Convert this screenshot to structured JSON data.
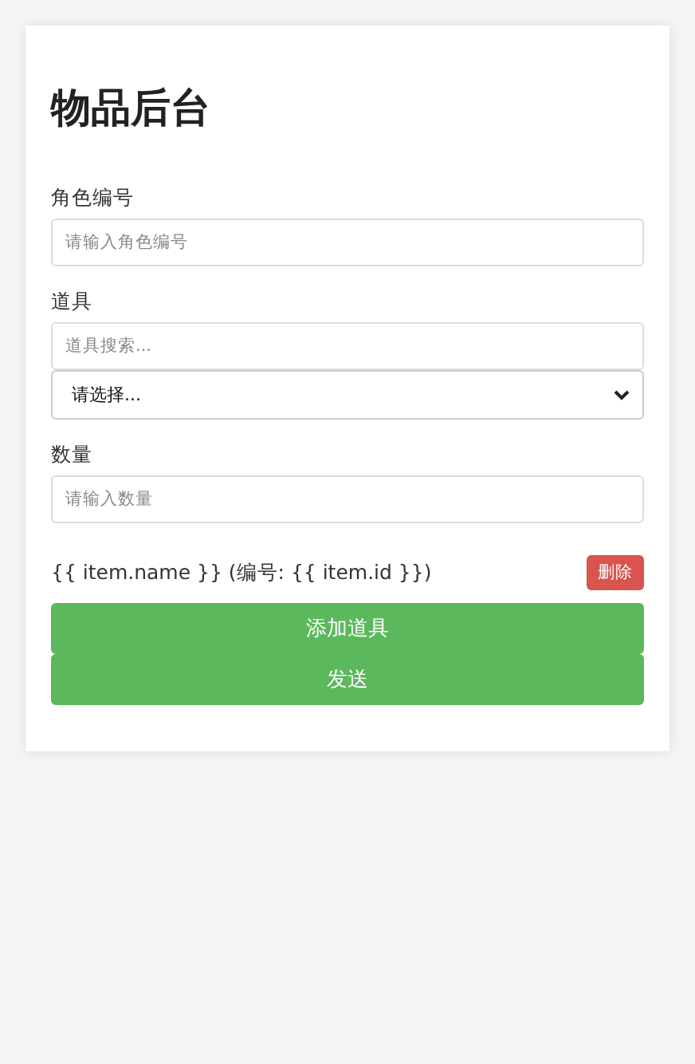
{
  "title": "物品后台",
  "fields": [
    {
      "label": "角色编号",
      "kind": "input",
      "placeholder": "请输入角色编号"
    },
    {
      "label": "道具",
      "kind": "search_select",
      "placeholder": "道具搜索...",
      "select_value": "请选择..."
    },
    {
      "label": "数量",
      "kind": "input",
      "placeholder": "请输入数量"
    }
  ],
  "item_row": {
    "text": "{{ item.name }} (编号: {{ item.id }})",
    "delete_button": "删除"
  },
  "buttons": [
    "添加道具",
    "发送"
  ]
}
